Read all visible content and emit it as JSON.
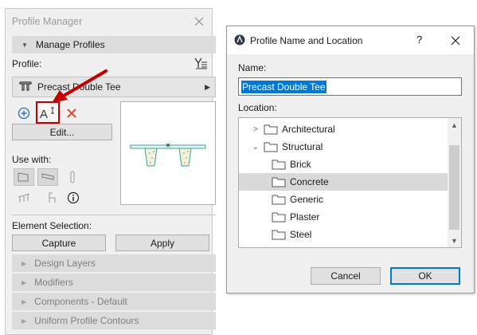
{
  "profile_manager": {
    "title": "Profile Manager",
    "manage_section": "Manage Profiles",
    "profile_label": "Profile:",
    "profile_value": "Precast Double Tee",
    "edit_button": "Edit...",
    "use_with_label": "Use with:",
    "element_selection_label": "Element Selection:",
    "capture_button": "Capture",
    "apply_button": "Apply",
    "collapsed_sections": [
      "Design Layers",
      "Modifiers",
      "Components - Default",
      "Uniform Profile Contours"
    ],
    "highlight_color": "#c00000"
  },
  "dialog": {
    "title": "Profile Name and Location",
    "help_label": "?",
    "name_label": "Name:",
    "name_value": "Precast Double Tee",
    "location_label": "Location:",
    "tree": [
      {
        "label": "Architectural",
        "level": 0,
        "expand": "collapsed"
      },
      {
        "label": "Structural",
        "level": 0,
        "expand": "expanded"
      },
      {
        "label": "Brick",
        "level": 1,
        "expand": "none"
      },
      {
        "label": "Concrete",
        "level": 1,
        "expand": "none",
        "selected": true
      },
      {
        "label": "Generic",
        "level": 1,
        "expand": "none"
      },
      {
        "label": "Plaster",
        "level": 1,
        "expand": "none"
      },
      {
        "label": "Steel",
        "level": 1,
        "expand": "none"
      }
    ],
    "cancel_button": "Cancel",
    "ok_button": "OK",
    "accent_color": "#0078d7"
  }
}
